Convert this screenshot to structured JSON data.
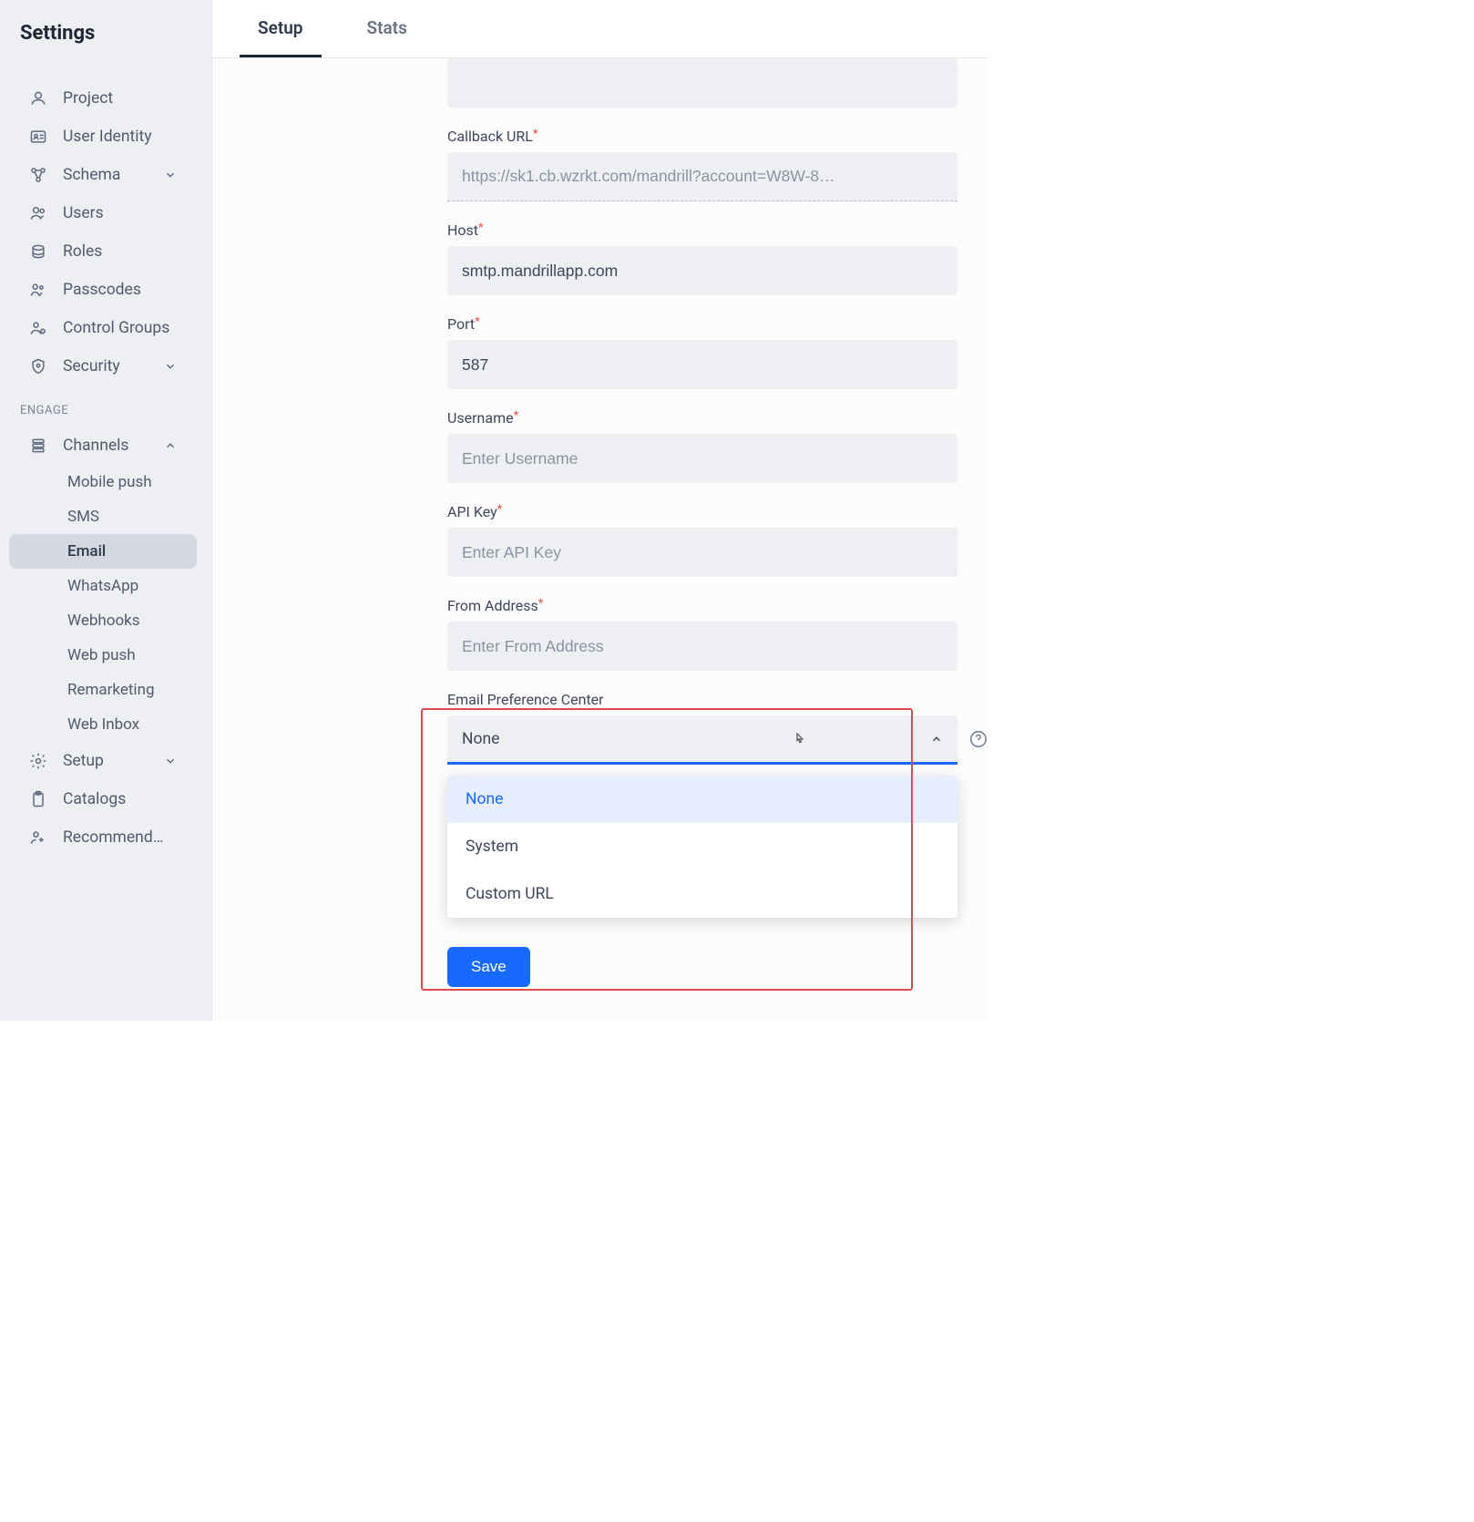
{
  "sidebar": {
    "title": "Settings",
    "items": [
      {
        "label": "Project",
        "icon": "user-icon",
        "chevron": false
      },
      {
        "label": "User Identity",
        "icon": "id-card-icon",
        "chevron": false
      },
      {
        "label": "Schema",
        "icon": "schema-icon",
        "chevron": true
      },
      {
        "label": "Users",
        "icon": "users-icon",
        "chevron": false
      },
      {
        "label": "Roles",
        "icon": "roles-icon",
        "chevron": false
      },
      {
        "label": "Passcodes",
        "icon": "passcodes-icon",
        "chevron": false
      },
      {
        "label": "Control Groups",
        "icon": "control-groups-icon",
        "chevron": false
      },
      {
        "label": "Security",
        "icon": "shield-icon",
        "chevron": true
      }
    ],
    "engage_label": "ENGAGE",
    "channels_label": "Channels",
    "channels": [
      {
        "label": "Mobile push",
        "active": false
      },
      {
        "label": "SMS",
        "active": false
      },
      {
        "label": "Email",
        "active": true
      },
      {
        "label": "WhatsApp",
        "active": false
      },
      {
        "label": "Webhooks",
        "active": false
      },
      {
        "label": "Web push",
        "active": false
      },
      {
        "label": "Remarketing",
        "active": false
      },
      {
        "label": "Web Inbox",
        "active": false
      }
    ],
    "setup_label": "Setup",
    "catalogs_label": "Catalogs",
    "recommend_label": "Recommend…"
  },
  "tabs": [
    {
      "label": "Setup",
      "active": true
    },
    {
      "label": "Stats",
      "active": false
    }
  ],
  "form": {
    "callback_label": "Callback URL",
    "callback_value": "https://sk1.cb.wzrkt.com/mandrill?account=W8W-8…",
    "host_label": "Host",
    "host_value": "smtp.mandrillapp.com",
    "port_label": "Port",
    "port_value": "587",
    "username_label": "Username",
    "username_placeholder": "Enter Username",
    "apikey_label": "API Key",
    "apikey_placeholder": "Enter API Key",
    "from_label": "From Address",
    "from_placeholder": "Enter From Address",
    "prefcenter_label": "Email Preference Center",
    "prefcenter_value": "None",
    "prefcenter_options": [
      "None",
      "System",
      "Custom URL"
    ],
    "save_label": "Save"
  }
}
